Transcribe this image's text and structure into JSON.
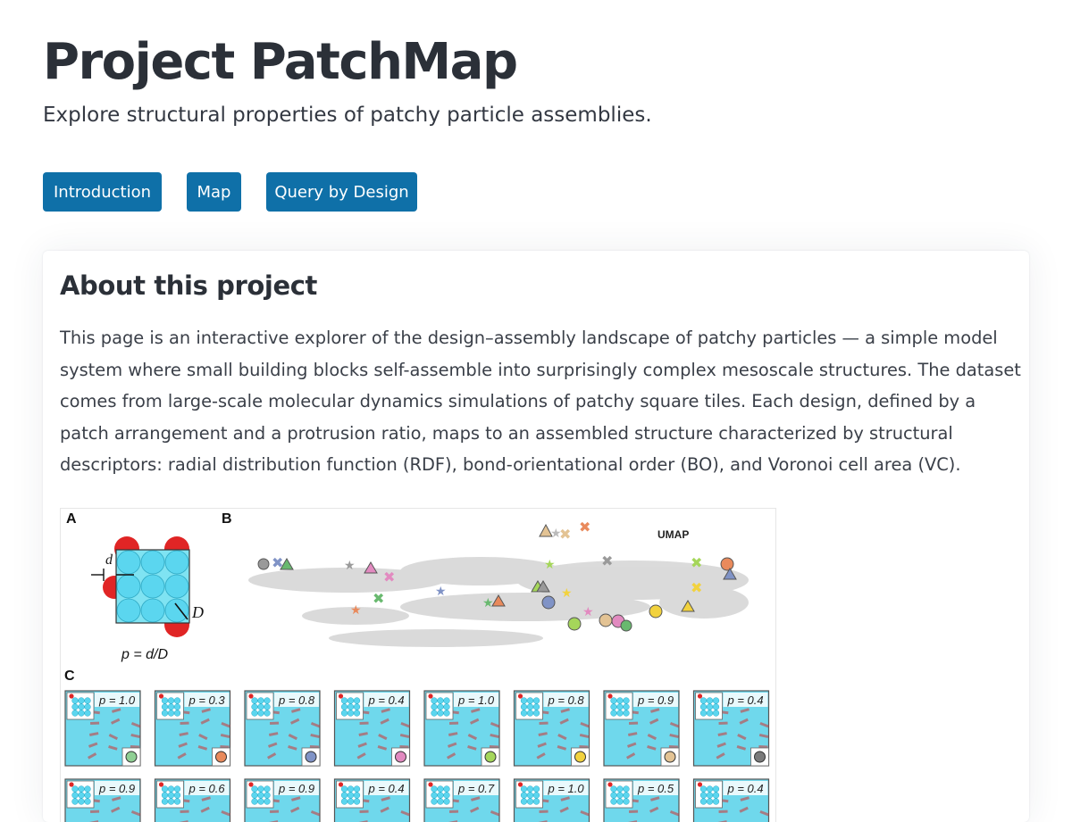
{
  "header": {
    "title": "Project PatchMap",
    "subtitle": "Explore structural properties of patchy particle assemblies."
  },
  "nav": {
    "items": [
      {
        "label": "Introduction"
      },
      {
        "label": "Map"
      },
      {
        "label": "Query by Design"
      }
    ],
    "color": "#0f70a8"
  },
  "about": {
    "heading": "About this project",
    "text": "This page is an interactive explorer of the design–assembly landscape of patchy particles — a simple model system where small building blocks self-assemble into surprisingly complex mesoscale structures. The dataset comes from large-scale molecular dynamics simulations of patchy square tiles. Each design, defined by a patch arrangement and a protrusion ratio, maps to an assembled structure characterized by structural descriptors: radial distribution function (RDF), bond-orientational order (BO), and Voronoi cell area (VC)."
  },
  "figure": {
    "panel_a": {
      "label": "A",
      "d_label": "d",
      "D_label": "D",
      "formula": "p = d/D"
    },
    "panel_b": {
      "label": "B",
      "map_label": "UMAP"
    },
    "panel_c": {
      "label": "C",
      "row1": [
        {
          "p": "p = 1.0",
          "marker": "#8fcf93"
        },
        {
          "p": "p = 0.3",
          "marker": "#e98a5c"
        },
        {
          "p": "p = 0.8",
          "marker": "#8093c6"
        },
        {
          "p": "p = 0.4",
          "marker": "#e28ac0"
        },
        {
          "p": "p = 1.0",
          "marker": "#a5d65a"
        },
        {
          "p": "p = 0.8",
          "marker": "#f2d23e"
        },
        {
          "p": "p = 0.9",
          "marker": "#e3c394"
        },
        {
          "p": "p = 0.4",
          "marker": "#7a7a7a"
        }
      ],
      "row2": [
        {
          "p": "p = 0.9"
        },
        {
          "p": "p = 0.6"
        },
        {
          "p": "p = 0.9"
        },
        {
          "p": "p = 0.4"
        },
        {
          "p": "p = 0.7"
        },
        {
          "p": "p = 1.0"
        },
        {
          "p": "p = 0.5"
        },
        {
          "p": "p = 0.4"
        }
      ]
    }
  }
}
